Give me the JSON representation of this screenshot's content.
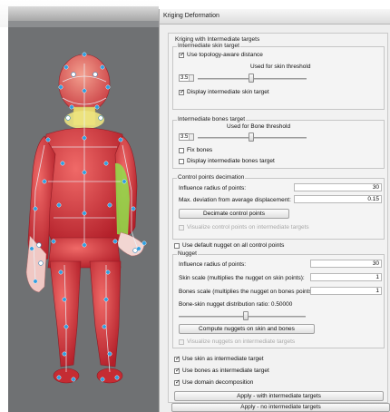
{
  "dialog": {
    "title": "Kriging Deformation",
    "main_group_label": "Kriging with Intermediate targets"
  },
  "skin_target": {
    "label": "Intermediate skin target",
    "use_topology": "Use topology-aware distance",
    "threshold_caption": "Used for skin threshold",
    "threshold_value": "3.5",
    "display_label": "Display intermediate skin target"
  },
  "bones_target": {
    "label": "Intermediate bones target",
    "threshold_caption": "Used for Bone threshold",
    "threshold_value": "3.5",
    "fix_bones": "Fix bones",
    "display_label": "Display intermediate bones target"
  },
  "decimation": {
    "label": "Control points decimation",
    "influence_label": "Influence radius of points:",
    "influence_value": "30",
    "max_dev_label": "Max. deviation from average displacement:",
    "max_dev_value": "0.15",
    "decimate_button": "Decimate control points",
    "visualize_label": "Visualize control points on intermediate targets"
  },
  "default_nugget": "Use default nugget on all control points",
  "nugget": {
    "label": "Nugget",
    "influence_label": "Influence radius of points:",
    "influence_value": "30",
    "skin_scale_label": "Skin scale (multiplies the nugget on skin points):",
    "skin_scale_value": "1",
    "bones_scale_label": "Bones scale (multiplies the nugget on bones points):",
    "bones_scale_value": "1",
    "ratio_label": "Bone-skin nugget distribution ratio: 0.50000",
    "compute_button": "Compute nuggets on skin and bones",
    "visualize_label": "Visualize nuggets on intermediate targets"
  },
  "options": {
    "use_skin": "Use skin as intermediate target",
    "use_bones": "Use bones as intermediate target",
    "use_domain": "Use domain decomposition"
  },
  "buttons": {
    "apply_with": "Apply - with intermediate targets",
    "apply_no": "Apply - no intermediate targets"
  },
  "colors": {
    "viewport_bg": "#6f7173",
    "body_red": "#d8373b",
    "highlight_yellow": "#e8e27a",
    "highlight_green": "#8fe04a",
    "node_blue": "#2f9fe0"
  }
}
